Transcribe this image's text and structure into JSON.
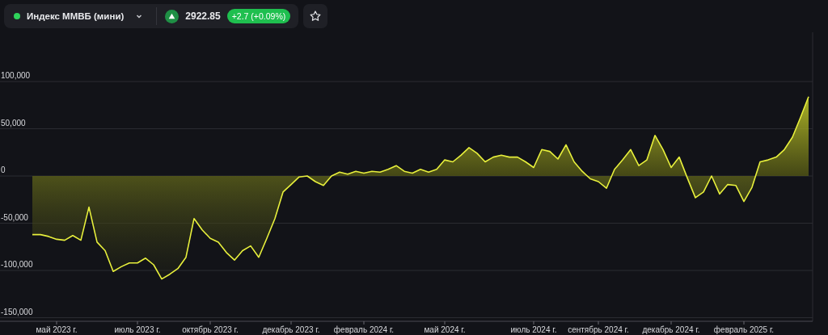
{
  "header": {
    "instrument": "Индекс ММВБ (мини)",
    "price": "2922.85",
    "change": "+2.7 (+0.09%)"
  },
  "chart_data": {
    "type": "area",
    "grid": true,
    "ylim": [
      -153800,
      150000
    ],
    "yticks": [
      {
        "value": -150000,
        "label": "-150,000"
      },
      {
        "value": -100000,
        "label": "-100,000"
      },
      {
        "value": -50000,
        "label": "-50,000"
      },
      {
        "value": 0,
        "label": "0"
      },
      {
        "value": 50000,
        "label": "50,000"
      },
      {
        "value": 100000,
        "label": "100,000"
      }
    ],
    "categories": [
      null,
      null,
      null,
      "май 2023 г.",
      null,
      null,
      null,
      null,
      null,
      null,
      null,
      null,
      null,
      "июль 2023 г.",
      null,
      null,
      null,
      null,
      null,
      null,
      null,
      null,
      "октябрь 2023 г.",
      null,
      null,
      null,
      null,
      null,
      null,
      null,
      null,
      null,
      "декабрь 2023 г.",
      null,
      null,
      null,
      null,
      null,
      null,
      null,
      null,
      "февраль 2024 г.",
      null,
      null,
      null,
      null,
      null,
      null,
      null,
      null,
      null,
      "май 2024 г.",
      null,
      null,
      null,
      null,
      null,
      null,
      null,
      null,
      null,
      null,
      "июль 2024 г.",
      null,
      null,
      null,
      null,
      null,
      null,
      null,
      "сентябрь 2024 г.",
      null,
      null,
      null,
      null,
      null,
      null,
      null,
      null,
      "декабрь 2024 г.",
      null,
      null,
      null,
      null,
      null,
      null,
      null,
      null,
      "февраль 2025 г.",
      null,
      null,
      null,
      null,
      null,
      null,
      null,
      null
    ],
    "series": [
      {
        "color": "#e8f03c",
        "values": [
          -62000,
          -62000,
          -64000,
          -67000,
          -68000,
          -63000,
          -68000,
          -33000,
          -70000,
          -79000,
          -101000,
          -96000,
          -92000,
          -92000,
          -87000,
          -94000,
          -109000,
          -104000,
          -98000,
          -86000,
          -45000,
          -57000,
          -66000,
          -70000,
          -81000,
          -89000,
          -79000,
          -74000,
          -86000,
          -66000,
          -45000,
          -17000,
          -9000,
          -1000,
          0,
          -6000,
          -10000,
          0,
          4000,
          2000,
          5000,
          3000,
          5000,
          4000,
          7000,
          11000,
          5000,
          3000,
          7000,
          4000,
          7000,
          17000,
          15000,
          22000,
          30000,
          24000,
          15000,
          20000,
          22000,
          20000,
          20000,
          15000,
          9000,
          28000,
          26000,
          18000,
          33000,
          15000,
          5000,
          -3000,
          -6000,
          -13000,
          7000,
          17000,
          28000,
          11000,
          17000,
          43000,
          28000,
          9000,
          20000,
          -2000,
          -23000,
          -17000,
          0,
          -19000,
          -9000,
          -10000,
          -27000,
          -12000,
          15000,
          17000,
          20000,
          28000,
          41000,
          62000,
          84000
        ]
      }
    ]
  }
}
